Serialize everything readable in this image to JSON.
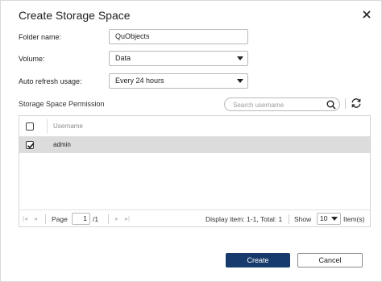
{
  "dialog": {
    "title": "Create Storage Space"
  },
  "form": {
    "folder_name": {
      "label": "Folder name:",
      "value": "QuObjects"
    },
    "volume": {
      "label": "Volume:",
      "value": "Data"
    },
    "auto_refresh": {
      "label": "Auto refresh usage:",
      "value": "Every 24 hours"
    }
  },
  "permission": {
    "label": "Storage Space Permission",
    "search_placeholder": "Search username",
    "columns": {
      "username": "Username"
    },
    "rows": [
      {
        "username": "admin",
        "checked": true
      }
    ]
  },
  "pager": {
    "first": "|◂",
    "prev": "◂",
    "next": "▸",
    "last": "▸|",
    "page_label": "Page",
    "page_value": "1",
    "page_total": "/1",
    "display": "Display item: 1-1, Total: 1",
    "show_label": "Show",
    "show_value": "10",
    "items_label": "Item(s)"
  },
  "buttons": {
    "create": "Create",
    "cancel": "Cancel"
  },
  "colors": {
    "primary": "#163a6b",
    "selected_row": "#dcdcdc"
  }
}
